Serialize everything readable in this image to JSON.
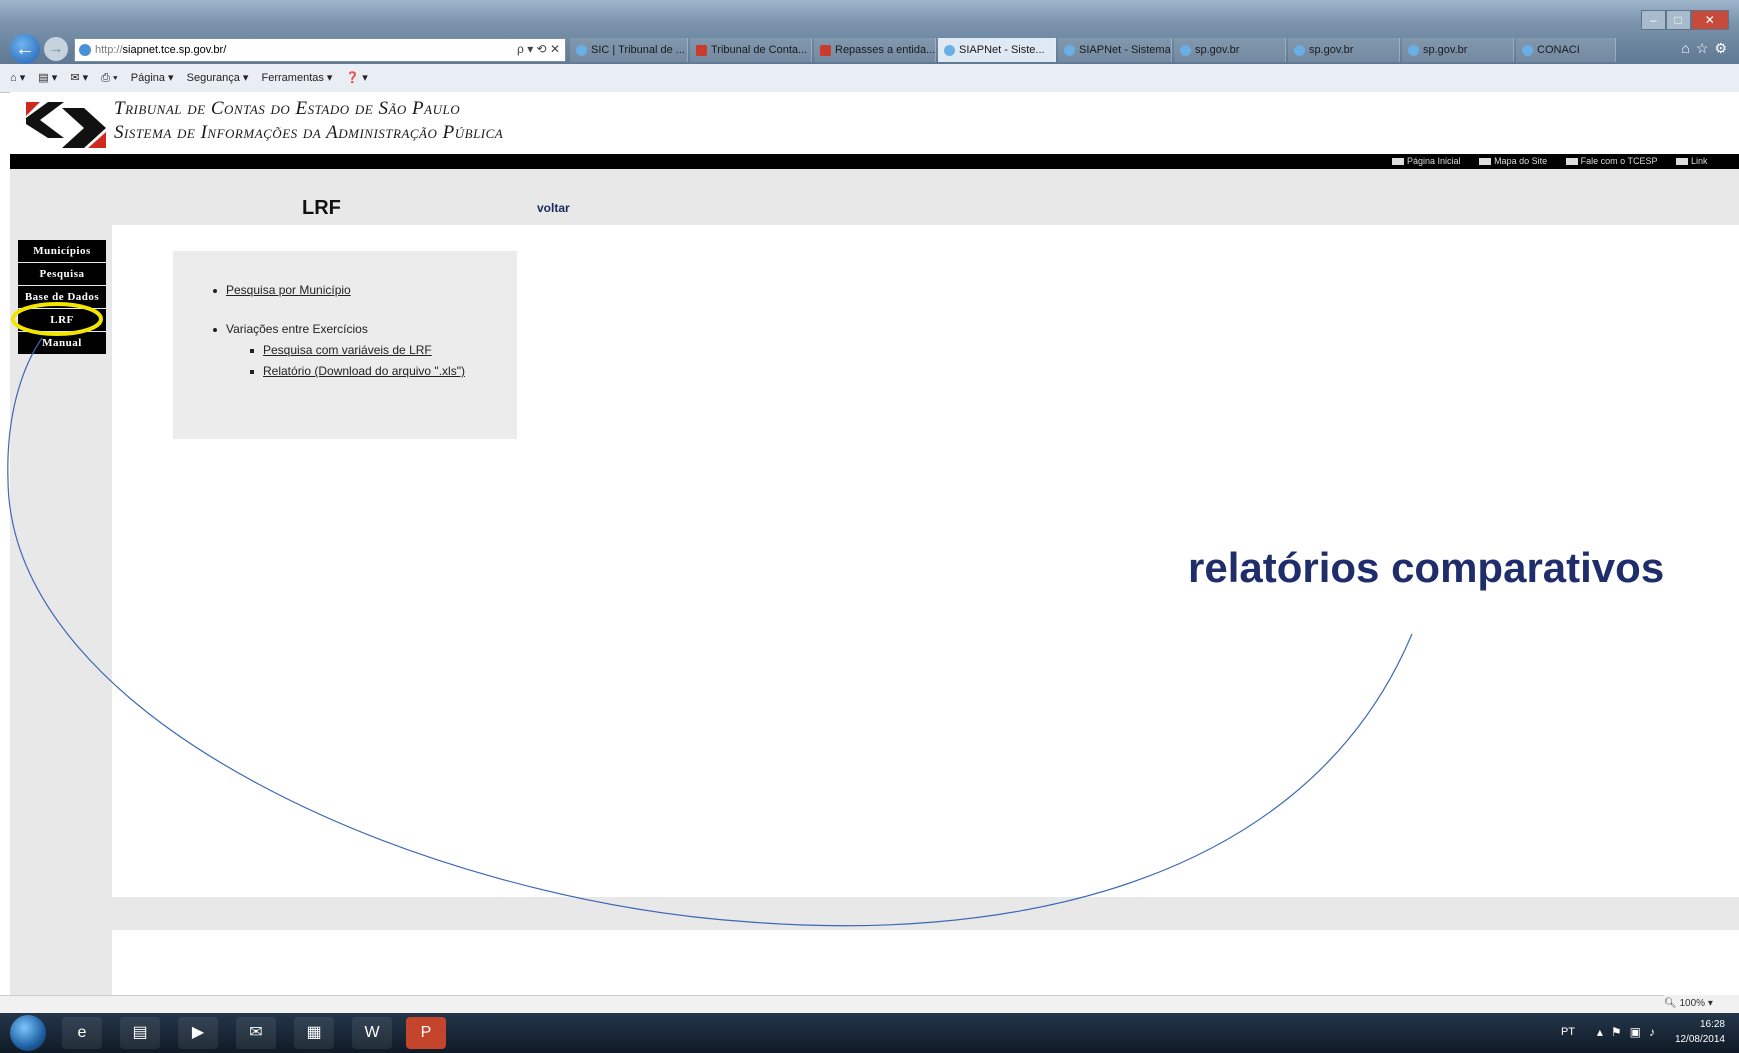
{
  "browser": {
    "address_proto": "http://",
    "address_host": "siapnet.tce.sp.gov.br/",
    "address_controls": "ρ ▾ ⟲ ✕",
    "tabs": [
      {
        "label": "SIC | Tribunal de ...",
        "icon": "ie-icon",
        "active": false
      },
      {
        "label": "Tribunal de Conta...",
        "icon": "tce-icon",
        "active": false
      },
      {
        "label": "Repasses a entida...",
        "icon": "tce-icon",
        "active": false
      },
      {
        "label": "SIAPNet - Siste...",
        "icon": "ie-icon",
        "active": true
      },
      {
        "label": "SIAPNet - Sistema...",
        "icon": "ie-icon",
        "active": false
      },
      {
        "label": "sp.gov.br",
        "icon": "ie-icon",
        "active": false
      },
      {
        "label": "sp.gov.br",
        "icon": "ie-icon",
        "active": false
      },
      {
        "label": "sp.gov.br",
        "icon": "ie-icon",
        "active": false
      },
      {
        "label": "CONACI",
        "icon": "ie-icon",
        "active": false
      }
    ],
    "commands": [
      "Página ▾",
      "Segurança ▾",
      "Ferramentas ▾"
    ],
    "zoom": "100%"
  },
  "site": {
    "title_line1": "Tribunal de Contas do Estado de São Paulo",
    "title_line2": "Sistema de Informações da Administração Pública",
    "top_links": [
      "Página Inicial",
      "Mapa do Site",
      "Fale com o TCESP",
      "Link"
    ]
  },
  "page": {
    "title": "LRF",
    "back_link": "voltar",
    "side_menu": [
      "Municípios",
      "Pesquisa",
      "Base de Dados",
      "LRF",
      "Manual"
    ],
    "links": {
      "item1": "Pesquisa por Município",
      "item2": "Variações entre Exercícios",
      "sub1": "Pesquisa com variáveis de LRF",
      "sub2": "Relatório (Download do arquivo \".xls\")"
    }
  },
  "annotation": {
    "text": "relatórios comparativos",
    "color": "#1f2d6b",
    "highlight_color": "#f2e600",
    "curve_color": "#3c68b4"
  },
  "taskbar": {
    "language": "PT",
    "time": "16:28",
    "date": "12/08/2014"
  }
}
